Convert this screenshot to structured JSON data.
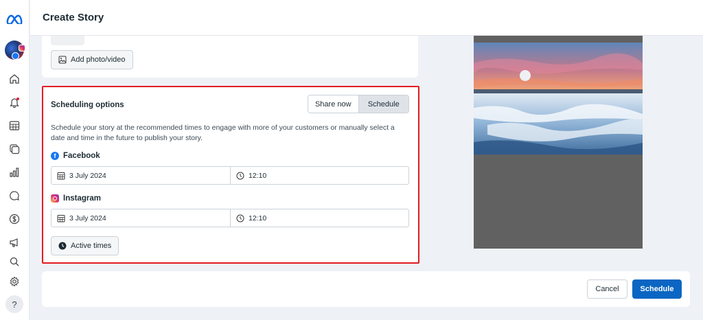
{
  "app": {
    "logo_icon": "meta-logo-icon",
    "brand_color": "#0668e1"
  },
  "header": {
    "title": "Create Story"
  },
  "sidebar": {
    "items": [
      {
        "name": "home",
        "icon": "home-icon"
      },
      {
        "name": "notifications",
        "icon": "bell-icon"
      },
      {
        "name": "planner",
        "icon": "calendar-grid-icon"
      },
      {
        "name": "content",
        "icon": "content-icon"
      },
      {
        "name": "insights",
        "icon": "bar-chart-icon"
      },
      {
        "name": "inbox",
        "icon": "chat-icon"
      },
      {
        "name": "monetization",
        "icon": "dollar-icon"
      },
      {
        "name": "ads",
        "icon": "megaphone-icon"
      },
      {
        "name": "search",
        "icon": "search-icon"
      },
      {
        "name": "settings",
        "icon": "gear-icon"
      }
    ],
    "help_label": "?"
  },
  "media": {
    "add_label": "Add photo/video"
  },
  "scheduling": {
    "title": "Scheduling options",
    "share_now_label": "Share now",
    "schedule_label": "Schedule",
    "description": "Schedule your story at the recommended times to engage with more of your customers or manually select a date and time in the future to publish your story.",
    "facebook": {
      "label": "Facebook",
      "date": "3 July 2024",
      "time": "12:10"
    },
    "instagram": {
      "label": "Instagram",
      "date": "3 July 2024",
      "time": "12:10"
    },
    "active_times_label": "Active times"
  },
  "footer": {
    "cancel_label": "Cancel",
    "schedule_label": "Schedule"
  },
  "colors": {
    "highlight_border": "#e31b23",
    "primary_button": "#0a66c2"
  }
}
